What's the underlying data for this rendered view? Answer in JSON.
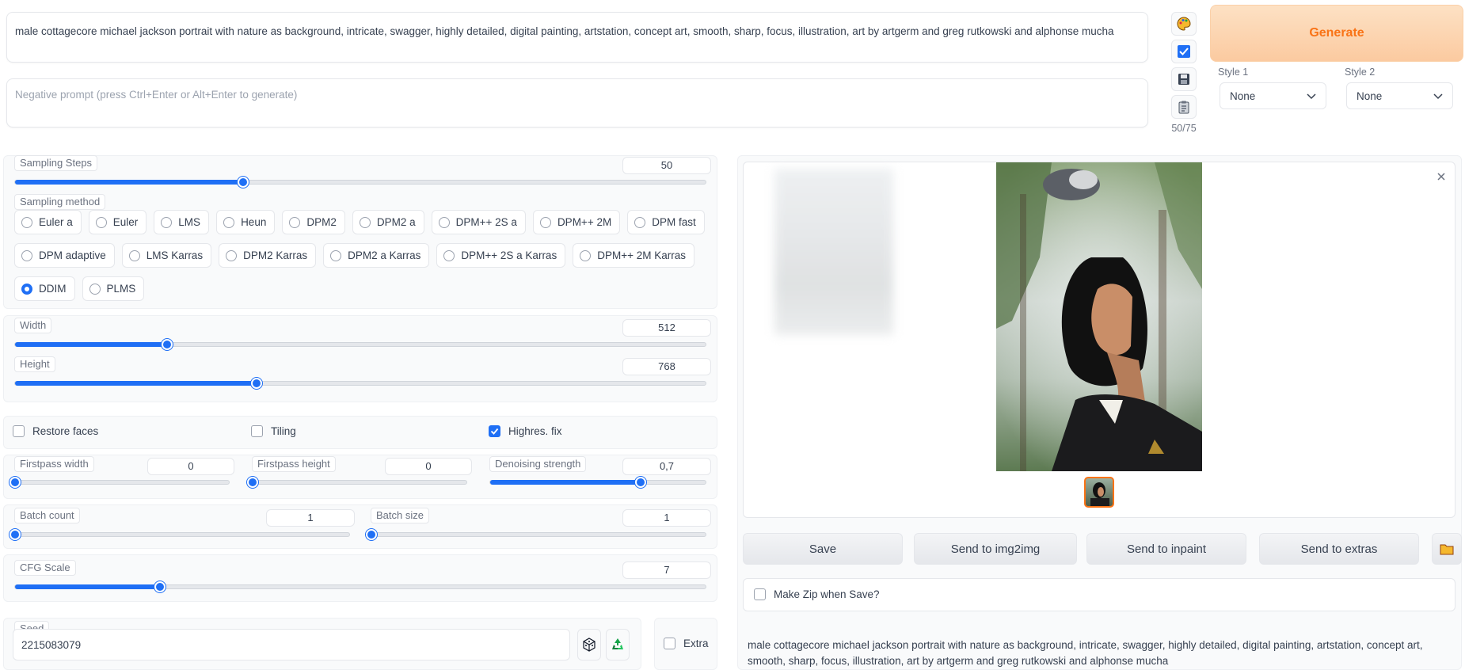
{
  "prompt": {
    "value": "male cottagecore michael jackson portrait with nature as background, intricate, swagger, highly detailed, digital painting, artstation, concept art, smooth, sharp, focus, illustration, art by artgerm and greg rutkowski and alphonse mucha"
  },
  "negative_prompt": {
    "placeholder": "Negative prompt (press Ctrl+Enter or Alt+Enter to generate)"
  },
  "tools": {
    "token_count": "50/75",
    "icons": [
      "palette-icon",
      "checkbox-icon",
      "save-icon",
      "clipboard-icon"
    ]
  },
  "generate": {
    "label": "Generate",
    "color": "#f97316",
    "bg": "#fcd7b0"
  },
  "styles": {
    "style1": {
      "label": "Style 1",
      "value": "None"
    },
    "style2": {
      "label": "Style 2",
      "value": "None"
    }
  },
  "sampling_steps": {
    "label": "Sampling Steps",
    "value": "50",
    "fraction": 0.33
  },
  "sampling_method": {
    "label": "Sampling method",
    "selected": "DDIM",
    "options_row1": [
      "Euler a",
      "Euler",
      "LMS",
      "Heun",
      "DPM2",
      "DPM2 a",
      "DPM++ 2S a",
      "DPM++ 2M",
      "DPM fast"
    ],
    "options_row2": [
      "DPM adaptive",
      "LMS Karras",
      "DPM2 Karras",
      "DPM2 a Karras",
      "DPM++ 2S a Karras",
      "DPM++ 2M Karras"
    ],
    "options_row3": [
      "DDIM",
      "PLMS"
    ]
  },
  "width": {
    "label": "Width",
    "value": "512",
    "fraction": 0.22
  },
  "height": {
    "label": "Height",
    "value": "768",
    "fraction": 0.35
  },
  "options": {
    "restore_faces": {
      "label": "Restore faces",
      "checked": false
    },
    "tiling": {
      "label": "Tiling",
      "checked": false
    },
    "highres_fix": {
      "label": "Highres. fix",
      "checked": true
    }
  },
  "firstpass_width": {
    "label": "Firstpass width",
    "value": "0",
    "fraction": 0
  },
  "firstpass_height": {
    "label": "Firstpass height",
    "value": "0",
    "fraction": 0
  },
  "denoising": {
    "label": "Denoising strength",
    "value": "0,7",
    "fraction": 0.7
  },
  "batch_count": {
    "label": "Batch count",
    "value": "1",
    "fraction": 0
  },
  "batch_size": {
    "label": "Batch size",
    "value": "1",
    "fraction": 0
  },
  "cfg_scale": {
    "label": "CFG Scale",
    "value": "7",
    "fraction": 0.21
  },
  "seed": {
    "label": "Seed",
    "value": "2215083079",
    "icons": [
      "dice-icon",
      "recycle-icon"
    ]
  },
  "extra": {
    "label": "Extra",
    "checked": false
  },
  "output": {
    "close_icon": "close-icon",
    "buttons": [
      "Save",
      "Send to img2img",
      "Send to inpaint",
      "Send to extras"
    ],
    "folder_icon": "folder-icon",
    "make_zip": {
      "label": "Make Zip when Save?",
      "checked": false
    },
    "info_text": "male cottagecore michael jackson portrait with nature as background, intricate, swagger, highly detailed, digital painting, artstation, concept art, smooth, sharp, focus, illustration, art by artgerm and greg rutkowski and alphonse mucha"
  },
  "colors": {
    "accent": "#1f6ff5",
    "thumb_border": "#f97316"
  }
}
